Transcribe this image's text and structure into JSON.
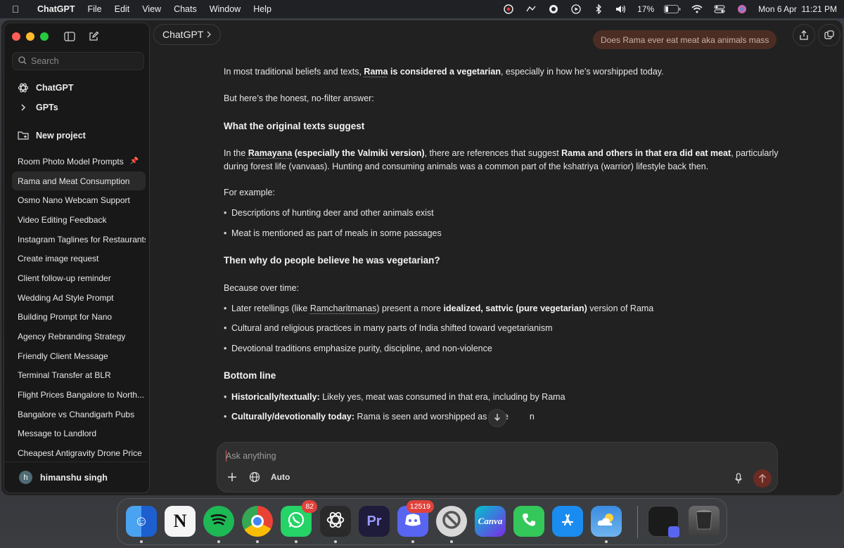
{
  "menubar": {
    "app": "ChatGPT",
    "menus": [
      "File",
      "Edit",
      "View",
      "Chats",
      "Window",
      "Help"
    ],
    "battery": "17%",
    "datetime": "Mon 6 Apr  11:21 PM"
  },
  "sidebar": {
    "search_placeholder": "Search",
    "nav": {
      "chatgpt": "ChatGPT",
      "gpts": "GPTs",
      "new_project": "New project"
    },
    "chats": [
      "Room Photo Model Prompts",
      "Rama and Meat Consumption",
      "Osmo Nano Webcam Support",
      "Video Editing Feedback",
      "Instagram Taglines for Restaurants",
      "Create image request",
      "Client follow-up reminder",
      "Wedding Ad Style Prompt",
      "Building Prompt for Nano",
      "Agency Rebranding Strategy",
      "Friendly Client Message",
      "Terminal Transfer at BLR",
      "Flight Prices Bangalore to North...",
      "Bangalore vs Chandigarh Pubs",
      "Message to Landlord",
      "Cheapest Antigravity Drone Price"
    ],
    "user": {
      "initial": "h",
      "name": "himanshu singh"
    }
  },
  "header": {
    "model": "ChatGPT",
    "user_message": "Does Rama ever eat meat aka animals mass"
  },
  "answer": {
    "p1_pre": "In most traditional beliefs and texts, ",
    "p1_b1": "Rama",
    "p1_b2": " is considered a vegetarian",
    "p1_post": ", especially in how he’s worshipped today.",
    "p2": "But here’s the honest, no-filter answer:",
    "h1": "What the original texts suggest",
    "p3_pre": "In the ",
    "p3_b1": "Ramayana",
    "p3_b2": " (especially the Valmiki version)",
    "p3_mid": ", there are references that suggest ",
    "p3_b3": "Rama and others in that era did eat meat",
    "p3_post": ", particularly during forest life (vanvaas). Hunting and consuming animals was a common part of the kshatriya (warrior) lifestyle back then.",
    "p4": "For example:",
    "b1": "Descriptions of hunting deer and other animals exist",
    "b2": "Meat is mentioned as part of meals in some passages",
    "h2": "Then why do people believe he was vegetarian?",
    "p5": "Because over time:",
    "b3_pre": "Later retellings (like ",
    "b3_link": "Ramcharitmanas",
    "b3_mid": ") present a more ",
    "b3_b": "idealized, sattvic (pure vegetarian)",
    "b3_post": " version of Rama",
    "b4": "Cultural and religious practices in many parts of India shifted toward vegetarianism",
    "b5": "Devotional traditions emphasize purity, discipline, and non-violence",
    "h3": "Bottom line",
    "b6_b": "Historically/textually:",
    "b6": " Likely yes, meat was consumed in that era, including by Rama",
    "b7_b": "Culturally/devotionally today:",
    "b7": " Rama is seen and worshipped as vege",
    "b7_tail": "n"
  },
  "composer": {
    "placeholder": "Ask anything",
    "mode": "Auto"
  },
  "dock": {
    "apps": [
      {
        "name": "Finder",
        "label": ""
      },
      {
        "name": "Notion",
        "label": "N"
      },
      {
        "name": "Spotify",
        "label": ""
      },
      {
        "name": "Chrome",
        "label": ""
      },
      {
        "name": "WhatsApp",
        "label": "",
        "badge": "82"
      },
      {
        "name": "ChatGPT",
        "label": ""
      },
      {
        "name": "Premiere",
        "label": "Pr"
      },
      {
        "name": "Discord",
        "label": "",
        "badge": "12519"
      },
      {
        "name": "Blocked",
        "label": ""
      },
      {
        "name": "Canva",
        "label": "Canva"
      },
      {
        "name": "Phone",
        "label": ""
      },
      {
        "name": "App Store",
        "label": ""
      },
      {
        "name": "Weather",
        "label": ""
      }
    ]
  },
  "colors": {
    "window_bg": "#212121",
    "sidebar_bg": "#181818",
    "user_bubble": "#4b2d24",
    "send_button": "#6b2a22",
    "badge": "#e0413a"
  }
}
